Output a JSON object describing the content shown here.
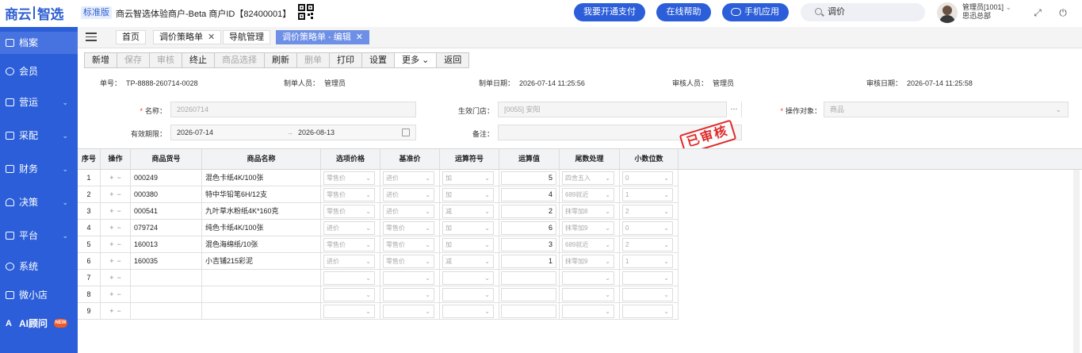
{
  "header": {
    "logo_left": "商云",
    "logo_right": "智选",
    "edition": "标准版",
    "tenant": "商云智选体验商户-Beta  商户ID【82400001】",
    "btn_pay": "我要开通支付",
    "btn_help": "在线帮助",
    "btn_mobile": "手机应用",
    "search_value": "调价",
    "user_name": "管理员[1001]",
    "user_dept": "思迅总部"
  },
  "sidebar": {
    "items": [
      {
        "label": "档案"
      },
      {
        "label": "会员"
      },
      {
        "label": "营运"
      },
      {
        "label": "采配"
      },
      {
        "label": "财务"
      },
      {
        "label": "决策"
      },
      {
        "label": "平台"
      },
      {
        "label": "系统"
      },
      {
        "label": "微小店"
      },
      {
        "label": "AI顾问"
      }
    ]
  },
  "tabs": [
    {
      "label": "首页"
    },
    {
      "label": "调价策略单"
    },
    {
      "label": "导航管理"
    },
    {
      "label": "调价策略单 - 编辑"
    }
  ],
  "toolbar": {
    "buttons": [
      {
        "label": "新增"
      },
      {
        "label": "保存"
      },
      {
        "label": "审核"
      },
      {
        "label": "终止"
      },
      {
        "label": "商品选择"
      },
      {
        "label": "刷新"
      },
      {
        "label": "删单"
      },
      {
        "label": "打印"
      },
      {
        "label": "设置"
      },
      {
        "label": "更多"
      },
      {
        "label": "返回"
      }
    ]
  },
  "info": {
    "doc_no_label": "单号：",
    "doc_no": "TP-8888-260714-0028",
    "maker_label": "制单人员：",
    "maker": "管理员",
    "make_date_label": "制单日期：",
    "make_date": "2026-07-14 11:25:56",
    "auditor_label": "审核人员：",
    "auditor": "管理员",
    "audit_date_label": "审核日期：",
    "audit_date": "2026-07-14 11:25:58"
  },
  "form": {
    "name_label": "名称：",
    "name_value": "20260714",
    "store_label": "生效门店：",
    "store_value": "[0055]  安阳",
    "target_label": "操作对象：",
    "target_value": "商品",
    "period_label": "有效期限：",
    "period_start": "2026-07-14",
    "period_end": "2026-08-13",
    "remark_label": "备注：",
    "remark_value": ""
  },
  "stamp": "已审核",
  "table": {
    "headers": [
      "序号",
      "操作",
      "商品货号",
      "商品名称",
      "选项价格",
      "基准价",
      "运算符号",
      "运算值",
      "尾数处理",
      "小数位数"
    ],
    "rows": [
      {
        "no": "1",
        "code": "000249",
        "name": "混色卡纸4K/100张",
        "price": "零售价",
        "base": "进价",
        "op": "加",
        "val": "5",
        "tail": "四舍五入",
        "dec": "0"
      },
      {
        "no": "2",
        "code": "000380",
        "name": "特中华铅笔6H/12支",
        "price": "零售价",
        "base": "进价",
        "op": "加",
        "val": "4",
        "tail": "689就近",
        "dec": "1"
      },
      {
        "no": "3",
        "code": "000541",
        "name": "九叶草水粉纸4K*160克",
        "price": "零售价",
        "base": "进价",
        "op": "减",
        "val": "2",
        "tail": "抹零加8",
        "dec": "2"
      },
      {
        "no": "4",
        "code": "079724",
        "name": "纯色卡纸4K/100张",
        "price": "进价",
        "base": "零售价",
        "op": "加",
        "val": "6",
        "tail": "抹零加9",
        "dec": "0"
      },
      {
        "no": "5",
        "code": "160013",
        "name": "混色海绵纸/10张",
        "price": "零售价",
        "base": "零售价",
        "op": "加",
        "val": "3",
        "tail": "689就近",
        "dec": "2"
      },
      {
        "no": "6",
        "code": "160035",
        "name": "小吉铺215彩泥",
        "price": "进价",
        "base": "零售价",
        "op": "减",
        "val": "1",
        "tail": "抹零加9",
        "dec": "1"
      },
      {
        "no": "7",
        "code": "",
        "name": "",
        "price": "",
        "base": "",
        "op": "",
        "val": "",
        "tail": "",
        "dec": ""
      },
      {
        "no": "8",
        "code": "",
        "name": "",
        "price": "",
        "base": "",
        "op": "",
        "val": "",
        "tail": "",
        "dec": ""
      },
      {
        "no": "9",
        "code": "",
        "name": "",
        "price": "",
        "base": "",
        "op": "",
        "val": "",
        "tail": "",
        "dec": ""
      }
    ]
  }
}
